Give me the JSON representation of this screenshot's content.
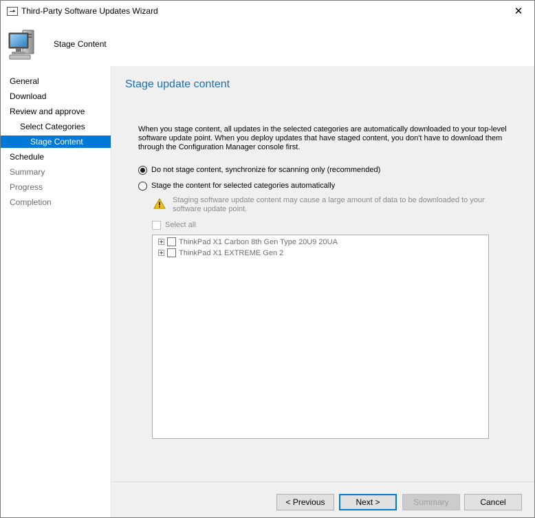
{
  "window": {
    "title": "Third-Party Software Updates Wizard",
    "close_glyph": "✕"
  },
  "banner": {
    "icon": "computer-icon",
    "title": "Stage Content"
  },
  "nav": {
    "items": [
      {
        "label": "General",
        "state": "normal"
      },
      {
        "label": "Download",
        "state": "normal"
      },
      {
        "label": "Review and approve",
        "state": "normal"
      },
      {
        "label": "Select Categories",
        "state": "normal"
      },
      {
        "label": "Stage Content",
        "state": "selected"
      },
      {
        "label": "Schedule",
        "state": "normal"
      },
      {
        "label": "Summary",
        "state": "disabled"
      },
      {
        "label": "Progress",
        "state": "disabled"
      },
      {
        "label": "Completion",
        "state": "disabled"
      }
    ]
  },
  "content": {
    "title": "Stage update content",
    "description": "When you stage content, all updates in the selected categories are automatically downloaded to your top-level software update point. When you deploy updates that have staged content, you don't have to download them through the Configuration Manager console first.",
    "options": {
      "no_stage": {
        "label": "Do not stage content, synchronize for scanning only (recommended)",
        "checked": true
      },
      "stage_auto": {
        "label": "Stage the content for selected categories automatically",
        "checked": false
      }
    },
    "warning": {
      "icon": "warning-icon",
      "text": "Staging software update content may cause a large amount of data to be downloaded to your software update point."
    },
    "select_all": {
      "label": "Select all",
      "checked": false
    },
    "tree": [
      {
        "label": "ThinkPad X1 Carbon 8th Gen Type 20U9 20UA",
        "checked": false
      },
      {
        "label": "ThinkPad X1 EXTREME Gen 2",
        "checked": false
      }
    ]
  },
  "footer": {
    "previous": "< Previous",
    "next": "Next >",
    "summary": "Summary",
    "cancel": "Cancel"
  },
  "colors": {
    "accent": "#0078d7",
    "title_blue": "#1a6fb4",
    "panel_bg": "#f0f0f0"
  }
}
